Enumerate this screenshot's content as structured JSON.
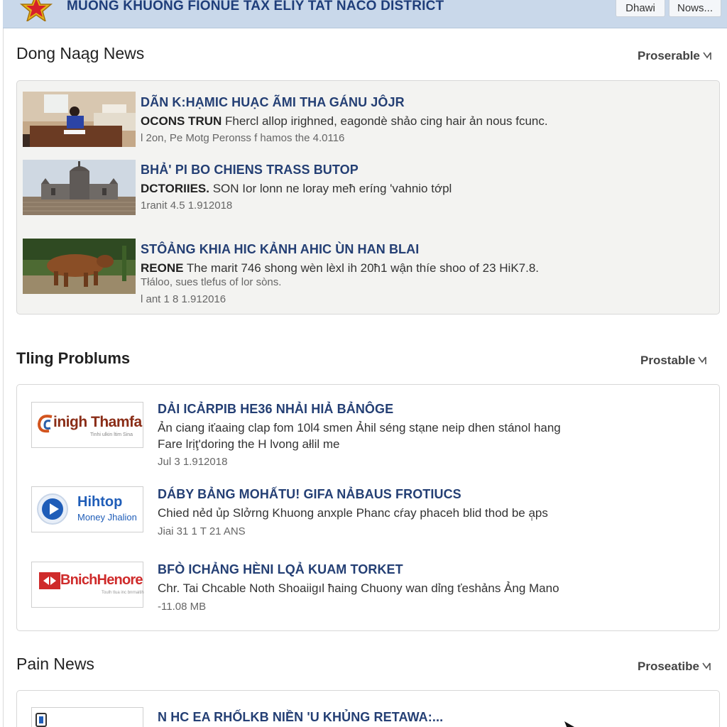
{
  "header": {
    "site_title": "MUONG KHUONG FIONUE TAX ELIY TAT NACO DISTRICT",
    "buttons": [
      "Dhawi",
      "Nows..."
    ]
  },
  "sections": [
    {
      "title": "Dong Naąg News",
      "sort_label": "Proserable",
      "items": [
        {
          "headline": "DÃN K:HẠMIC HUẠC ÃMI THA GÁNU JÔJR",
          "summary_lead": "OCONS TRUN",
          "summary": " Fhercl allop irighned, eagondè shảo cing hair ản nous fcunc.",
          "extra": "",
          "meta": "l 2on, Pe Motg Peronss f hamos the 4.0116",
          "thumb": "room-scene"
        },
        {
          "headline": "BHẢ' PI BO CHIENS TRASS BUTOP",
          "summary_lead": "DCTORIIES.",
          "summary": " SON Ior lonn ne loray meħ eríng 'vahnio tớpl",
          "extra": "",
          "meta": "1ranit 4.5 1.912018",
          "thumb": "cathedral-scene"
        },
        {
          "headline": "STÔẢNG KHIA HIC KẢNH AHIC ÙN HAN BLAI",
          "summary_lead": "REONE",
          "summary": " The marit 746 shong wèn lèxl ih 20ħ1 wận thíe shoo of 23 HiK7.8.",
          "extra": "Tłáloo, sues tlefus of lor sòns.",
          "meta": "l ant 1 8 1.912016",
          "thumb": "buffalo-scene"
        }
      ]
    },
    {
      "title": "Tling Problums",
      "sort_label": "Prostable",
      "items": [
        {
          "headline": "DẢI ICẢRPIB HE36 NHẢI HIẢ BẢNÔGE",
          "summary": "Ản ciang iťaaing clap fom 10l4 smen Ảhil séng stạne neip dhen stánol hang",
          "extra": "Fare lrịţ'doring the H lvong ałlil me",
          "meta": "Jul 3 1.912018",
          "logo": {
            "name": "inigh Thamfa",
            "sub": "Tinhi ulkin ltim Sina"
          }
        },
        {
          "headline": "DÁBY BẢNG MOHẤTU! GIFA NẢBAUS FROTIUCS",
          "summary": "Chied nẻd ủp Slởrng Khuong anxple Phanc cŕay phaceh blid thod be ạ̣ps",
          "extra": "",
          "meta": "Jiai 31 1 T 21 ANS",
          "logo": {
            "name": "Hihtop",
            "sub": "Money Jhalion"
          }
        },
        {
          "headline": "BFÒ ICHẢNG HÈNI LQẢ KUAM TORKET",
          "summary": "Chr. Tai Chcable Noth Shoaiigıl ħaing Chuony wan dỉng ťeshảns Ảng Mano",
          "extra": "",
          "meta": "-11.08 MB",
          "logo": {
            "name": "BnichHenore",
            "sub": "Toulh tlua inc bnrnaitih"
          }
        }
      ]
    },
    {
      "title": "Pain News",
      "sort_label": "Proseatibe",
      "items": [
        {
          "headline": "N HC EA RHỐLKB NIỀN 'U KHỦNG RETAWA:...",
          "logo": {
            "name": "",
            "sub": ""
          }
        }
      ]
    }
  ],
  "colors": {
    "header_bg": "#c9d8ea",
    "title_blue": "#1f3e7a",
    "headline_blue": "#243f74",
    "star": "#e6b417"
  }
}
